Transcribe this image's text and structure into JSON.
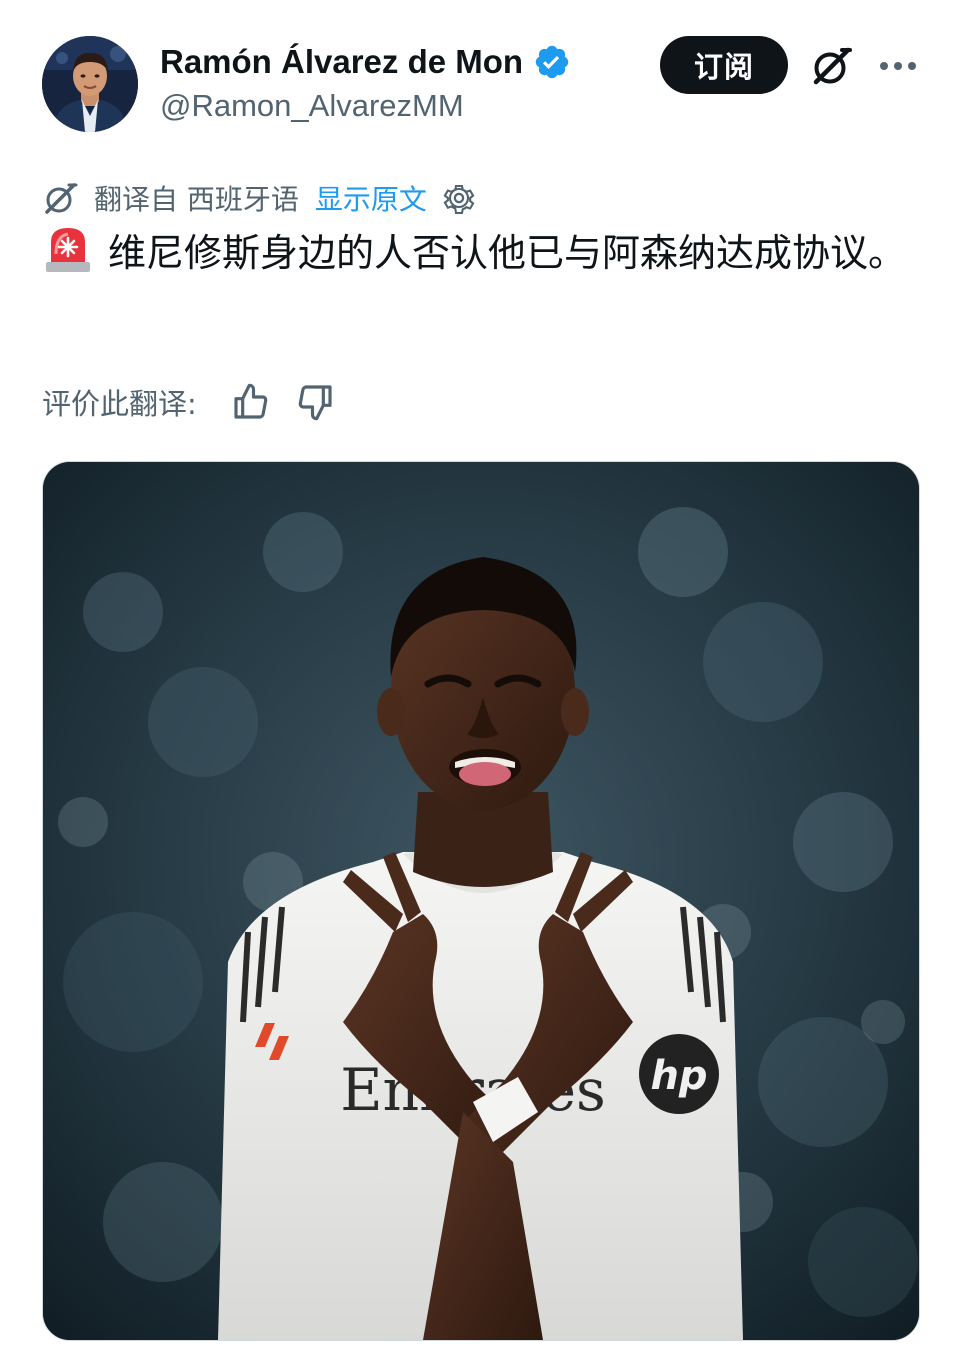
{
  "author": {
    "display_name": "Ramón Álvarez de Mon",
    "handle": "@Ramon_AlvarezMM",
    "verified": true,
    "avatar": "avatar-photo"
  },
  "actions": {
    "subscribe_label": "订阅",
    "grok_icon": "grok-icon",
    "more_icon": "more-dots-icon"
  },
  "translation": {
    "icon": "translate-icon",
    "translated_from": "翻译自 西班牙语",
    "show_original": "显示原文",
    "settings_icon": "gear-icon"
  },
  "tweet": {
    "emoji": "rotating-light-emoji",
    "text": "维尼修斯身边的人否认他已与阿森纳达成协议。"
  },
  "rating": {
    "label": "评价此翻译:",
    "thumbs_up_icon": "thumbs-up-icon",
    "thumbs_down_icon": "thumbs-down-icon"
  },
  "media": {
    "type": "photo",
    "jersey_sponsor_text": "Emirates",
    "sleeve_logo_text": "hp"
  },
  "colors": {
    "text_primary": "#0f1419",
    "text_secondary": "#536471",
    "link": "#1d9bf0",
    "verified": "#1d9bf0",
    "button_bg": "#0f1419"
  }
}
